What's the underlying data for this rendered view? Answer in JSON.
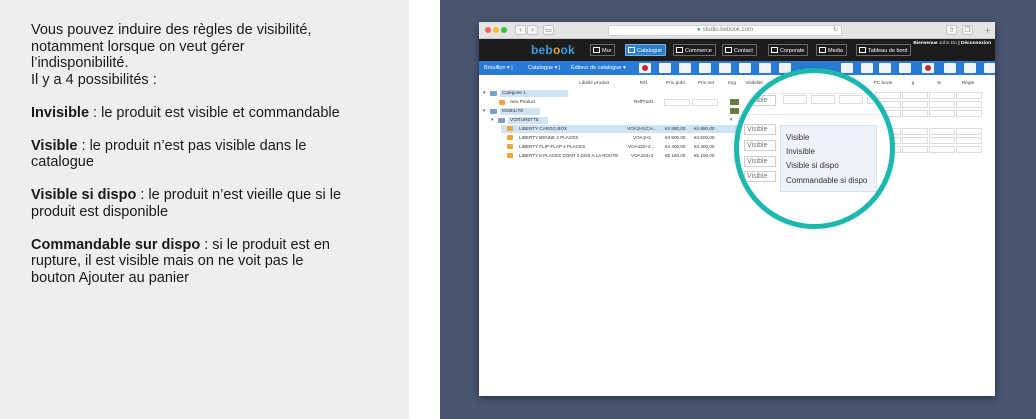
{
  "explanation": {
    "intro_lines": [
      "Vous pouvez induire des règles de visibilité,",
      "notamment lorsque on veut gérer",
      "l’indisponibilité.",
      "Il y a 4 possibilités :"
    ],
    "items": [
      {
        "term": "Invisible",
        "desc_lines": [
          " : le produit est visible et commandable"
        ]
      },
      {
        "term": "Visible",
        "desc_lines": [
          " : le produit n’est pas visible dans le",
          "catalogue"
        ]
      },
      {
        "term": "Visible si dispo",
        "desc_lines": [
          " : le produit n’est vieille que si le",
          "produit est disponible"
        ]
      },
      {
        "term": "Commandable sur dispo",
        "desc_lines": [
          " : si le produit est en",
          "rupture, il est visible mais on ne voit pas le",
          "bouton Ajouter au panier"
        ]
      }
    ]
  },
  "browser": {
    "url": "studio.bebook.com",
    "tabs_icon": "tabs-icon",
    "back_glyph": "‹",
    "forward_glyph": "›",
    "sidebar_glyph": "▭",
    "refresh_glyph": "↻",
    "share_glyph": "⇧",
    "duplicate_glyph": "❐",
    "new_tab_glyph": "+"
  },
  "app": {
    "logo_prefix": "beb",
    "logo_mid": "o",
    "logo_suffix": "ok",
    "nav": [
      {
        "label": "Mur",
        "icon": "pencil-icon",
        "active": false
      },
      {
        "label": "Catalogue",
        "icon": "catalog-icon",
        "active": true
      },
      {
        "label": "Commerce",
        "icon": "cart-icon",
        "active": false
      },
      {
        "label": "Contact",
        "icon": "people-icon",
        "active": false
      },
      {
        "label": "Corporate",
        "icon": "corporate-icon",
        "active": false
      },
      {
        "label": "Media",
        "icon": "image-icon",
        "active": false
      },
      {
        "label": "Tableau de bord",
        "icon": "dashboard-icon",
        "active": false
      }
    ],
    "user": {
      "greeting": "Bienvenue",
      "name": "John Do",
      "separator": "|",
      "logout": "Déconnexion"
    },
    "accent_color": "#2a7bd6",
    "header_color": "#1c1c1c"
  },
  "toolbar": {
    "selects": [
      {
        "label": "Brouillon"
      },
      {
        "label": "Catalogue"
      },
      {
        "label": "Éditeur de catalogue"
      }
    ]
  },
  "table": {
    "columns": [
      "Libellé produit",
      "Réf.",
      "Prix publ.",
      "Prix net",
      "Img",
      "Visibilité",
      "PC brute",
      "g",
      "%",
      "Règle"
    ],
    "rows": [
      {
        "type": "folder",
        "label": "Catégorie 1",
        "ref": "",
        "pub": "",
        "net": ""
      },
      {
        "type": "product",
        "label": "new Product",
        "ref": "RefProd1",
        "pub": "",
        "net": ""
      },
      {
        "type": "folder",
        "label": "MOBILITÉ",
        "ref": "",
        "pub": "",
        "net": ""
      },
      {
        "type": "folder",
        "label": "VOITURETTE",
        "ref": "",
        "pub": "",
        "net": ""
      },
      {
        "type": "product",
        "label": "LIBERTY CARGO BOX",
        "ref": "VOA1H1/CA...",
        "pub": "€4 880,00",
        "net": "€4 880,00"
      },
      {
        "type": "product",
        "label": "LIBERTY BENNE 2 PLACES",
        "ref": "VOA1H1",
        "pub": "€4 500,00",
        "net": "€4 500,00"
      },
      {
        "type": "product",
        "label": "LIBERTY FLIP-FLAP 4 PLACES",
        "ref": "VOA152+2...",
        "pub": "€4 400,00",
        "net": "€4 400,00"
      },
      {
        "type": "product",
        "label": "LIBERTY 6 PLACES DONT 2 DOS A LA ROUTE",
        "ref": "VOA154+2",
        "pub": "€5 150,00",
        "net": "€5 150,00"
      }
    ]
  },
  "visibility": {
    "box_label": "Visible",
    "options": [
      "Visible",
      "Invisible",
      "Visible si dispo",
      "Commandable si dispo"
    ],
    "highlight_color": "#1ab8ae"
  }
}
